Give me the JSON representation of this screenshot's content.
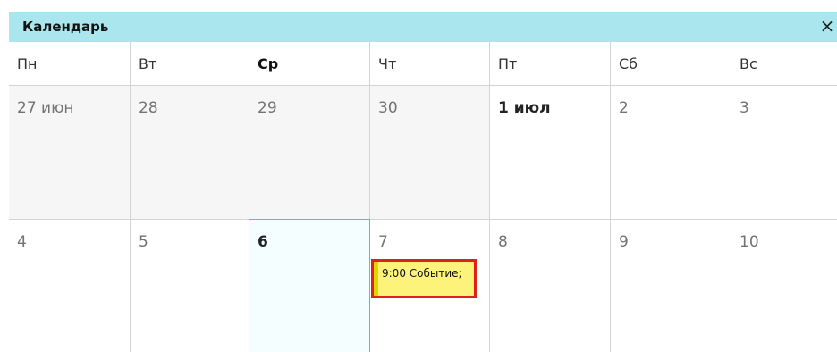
{
  "window": {
    "title": "Календарь",
    "close_symbol": "×"
  },
  "weekdays": [
    "Пн",
    "Вт",
    "Ср",
    "Чт",
    "Пт",
    "Сб",
    "Вс"
  ],
  "weeks": [
    {
      "days": [
        "27 июн",
        "28",
        "29",
        "30",
        "1 июл",
        "2",
        "3"
      ]
    },
    {
      "days": [
        "4",
        "5",
        "6",
        "7",
        "8",
        "9",
        "10"
      ]
    }
  ],
  "event": {
    "time": "9:00",
    "label": "Событие;"
  },
  "colors": {
    "titlebar": "#a9e6ee",
    "today_border": "#47c3d6",
    "event_fill": "#fef37a",
    "event_border": "#e0201b"
  }
}
